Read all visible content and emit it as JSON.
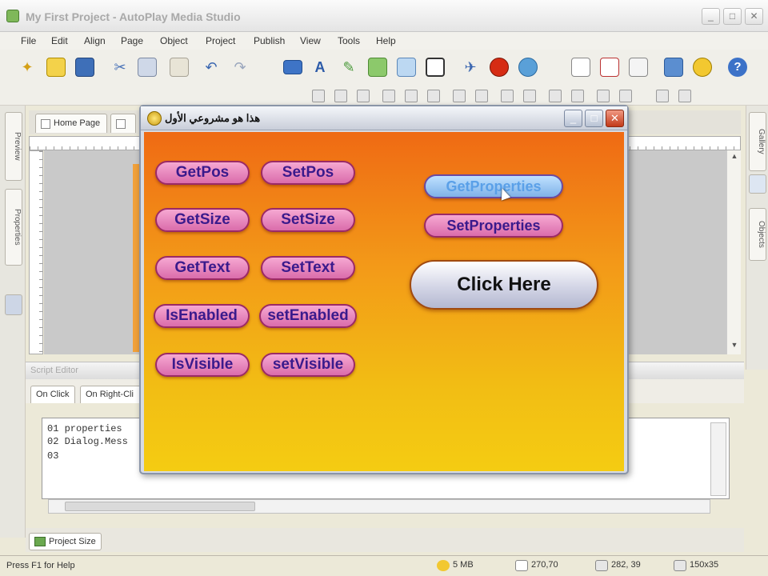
{
  "app": {
    "title": "My First Project - AutoPlay Media Studio",
    "window_buttons": [
      "_",
      "□",
      "✕"
    ]
  },
  "menu": [
    "File",
    "Edit",
    "Align",
    "Page",
    "Object",
    "Project",
    "Publish",
    "View",
    "Tools",
    "Help"
  ],
  "left_panel_tabs": [
    "Preview",
    "Properties"
  ],
  "right_panel_tabs": [
    "Gallery",
    "Objects"
  ],
  "doc_tabs": [
    {
      "label": "Home Page"
    }
  ],
  "script_editor": {
    "title": "Script Editor",
    "tabs": [
      "On Click",
      "On Right-Cli"
    ],
    "lines": [
      "01 properties",
      "02 Dialog.Mess",
      "03"
    ]
  },
  "bottom_tabs": [
    "Project Size"
  ],
  "status": {
    "help": "Press F1 for Help",
    "size": "5 MB",
    "pos1": "270,70",
    "pos2": "282, 39",
    "dims": "150x35"
  },
  "dialog": {
    "title": "هذا هو مشروعي الأول",
    "buttons": {
      "get_pos": "GetPos",
      "set_pos": "SetPos",
      "get_size": "GetSize",
      "set_size": "SetSize",
      "get_text": "GetText",
      "set_text": "SetText",
      "is_enabled": "IsEnabled",
      "set_enabled": "setEnabled",
      "is_visible": "IsVisible",
      "set_visible": "setVisible",
      "get_properties": "GetProperties",
      "set_properties": "SetProperties",
      "click_here": "Click Here"
    }
  },
  "colors": {
    "stage_top": "#ef6a14",
    "stage_bottom": "#f4cc12",
    "pill_fill": "#da6cab",
    "pill_text": "#3a1a8c",
    "hover_fill": "#7fb2e8"
  }
}
